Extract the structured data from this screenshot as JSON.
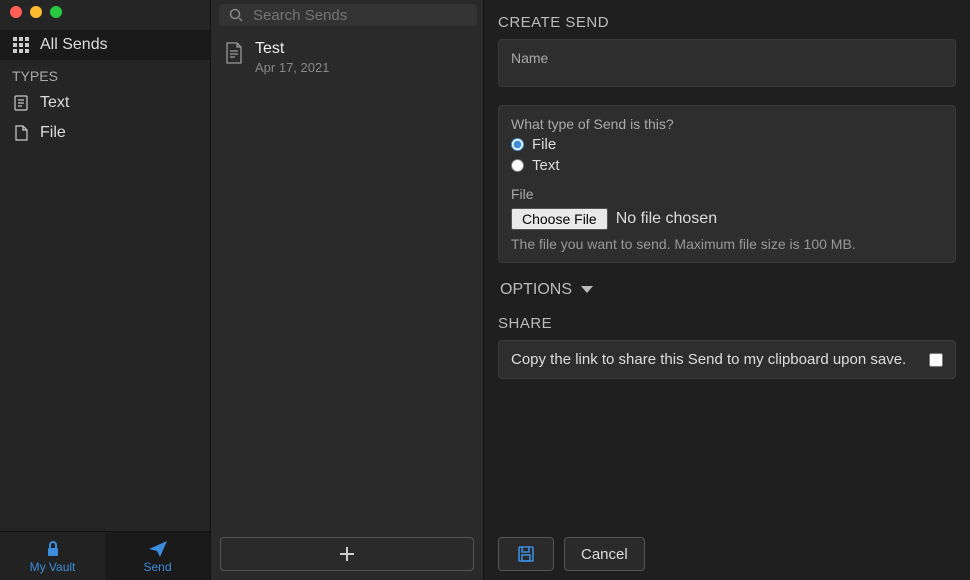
{
  "sidebar": {
    "nav": [
      {
        "label": "All Sends",
        "icon": "grid-icon",
        "selected": true
      }
    ],
    "types_header": "TYPES",
    "types": [
      {
        "label": "Text",
        "icon": "text-icon"
      },
      {
        "label": "File",
        "icon": "file-icon"
      }
    ],
    "bottom": [
      {
        "label": "My Vault",
        "icon": "lock-icon",
        "active": false
      },
      {
        "label": "Send",
        "icon": "send-icon",
        "active": true
      }
    ]
  },
  "search": {
    "placeholder": "Search Sends"
  },
  "list": [
    {
      "title": "Test",
      "subtitle": "Apr 17, 2021"
    }
  ],
  "new_button": {
    "icon": "plus-icon"
  },
  "detail": {
    "create_header": "CREATE SEND",
    "name_label": "Name",
    "type_q": "What type of Send is this?",
    "type_file": "File",
    "type_text": "Text",
    "type_selected": "File",
    "file_label": "File",
    "choose_label": "Choose File",
    "file_status": "No file chosen",
    "file_helper": "The file you want to send. Maximum file size is 100 MB.",
    "options_header": "OPTIONS",
    "share_header": "SHARE",
    "share_copy_label": "Copy the link to share this Send to my clipboard upon save.",
    "cancel_label": "Cancel"
  }
}
